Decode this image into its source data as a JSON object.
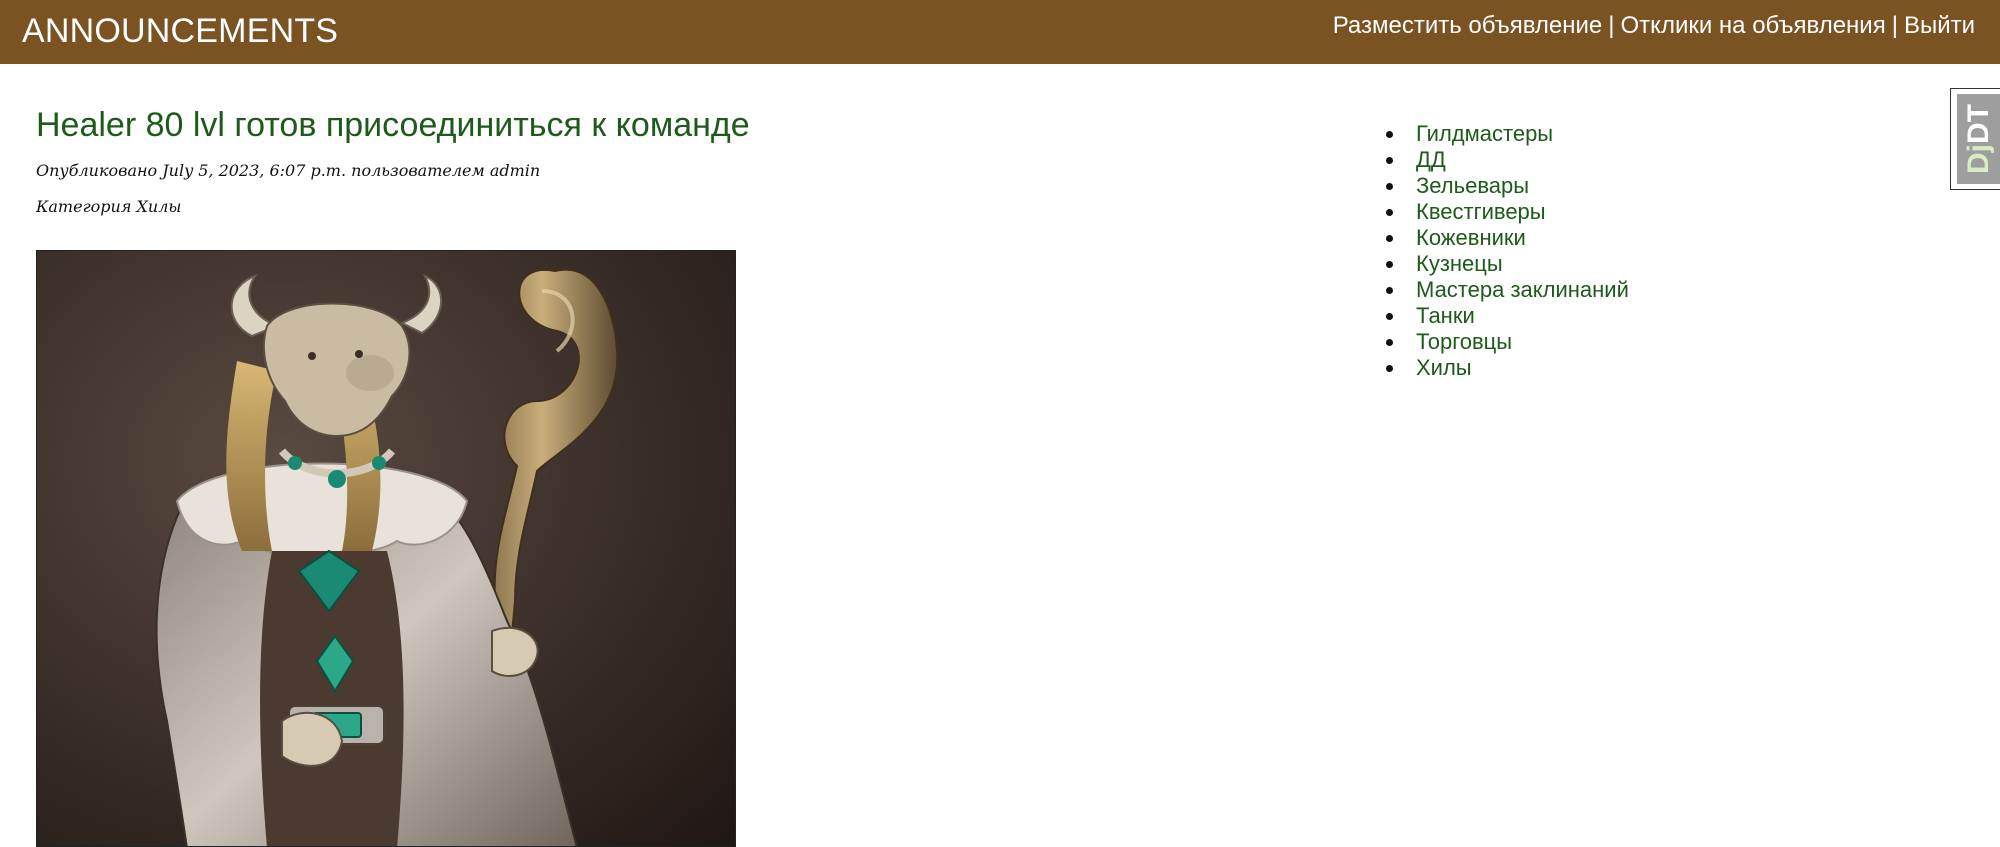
{
  "header": {
    "brand": "ANNOUNCEMENTS",
    "nav": [
      {
        "label": "Разместить объявление"
      },
      {
        "label": "Отклики на объявления"
      },
      {
        "label": "Выйти"
      }
    ],
    "separator": "|",
    "background_color": "#7b5222"
  },
  "post": {
    "title": "Healer 80 lvl готов присоединиться к команде",
    "published": "Опубликовано July 5, 2023, 6:07 p.m. пользователем admin",
    "category": "Категория Хилы",
    "image_subject": "horned fur-robed healer character holding a twisted wooden staff"
  },
  "sidebar": {
    "categories": [
      "Гилдмастеры",
      "ДД",
      "Зельевары",
      "Квестгиверы",
      "Кожевники",
      "Кузнецы",
      "Мастера заклинаний",
      "Танки",
      "Торговцы",
      "Хилы"
    ]
  },
  "toolbar_handle": {
    "prefix": "Dj",
    "suffix": "DT"
  },
  "colors": {
    "link_green": "#1e5a1a",
    "header_brown": "#7b5222"
  }
}
